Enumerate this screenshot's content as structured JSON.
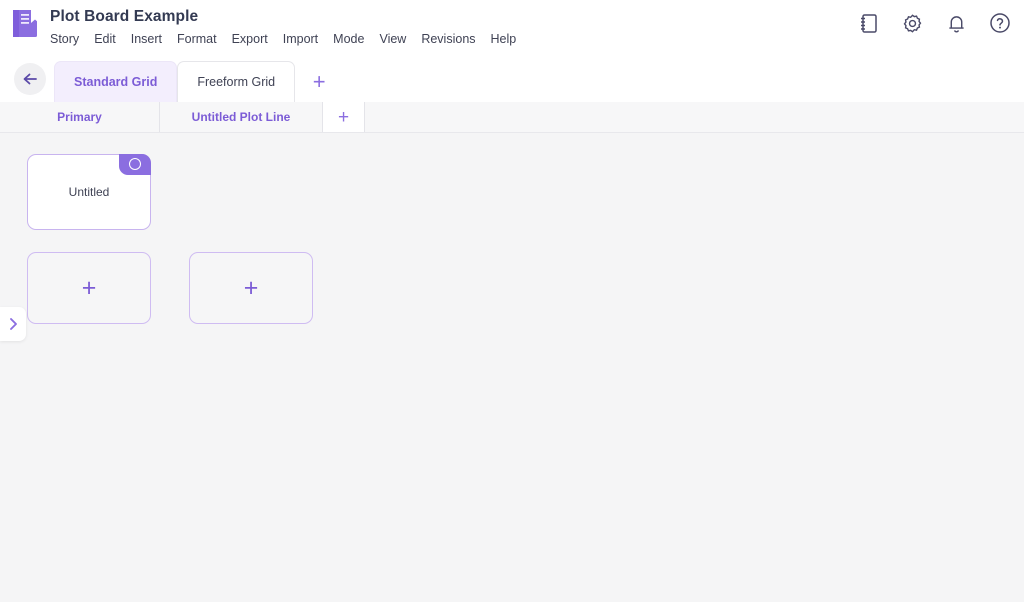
{
  "header": {
    "logo_icon": "book-logo-icon",
    "title": "Plot Board Example",
    "menu": [
      {
        "label": "Story"
      },
      {
        "label": "Edit"
      },
      {
        "label": "Insert"
      },
      {
        "label": "Format"
      },
      {
        "label": "Export"
      },
      {
        "label": "Import"
      },
      {
        "label": "Mode"
      },
      {
        "label": "View"
      },
      {
        "label": "Revisions"
      },
      {
        "label": "Help"
      }
    ],
    "actions": [
      {
        "icon": "notebook-icon"
      },
      {
        "icon": "gear-icon"
      },
      {
        "icon": "bell-icon"
      },
      {
        "icon": "help-circle-icon"
      }
    ]
  },
  "grid_tabs": {
    "back_icon": "arrow-left-icon",
    "tabs": [
      {
        "label": "Standard Grid",
        "active": true
      },
      {
        "label": "Freeform Grid",
        "active": false
      }
    ],
    "add_label": "+"
  },
  "plot_lines": {
    "cells": [
      {
        "label": "Primary"
      },
      {
        "label": "Untitled Plot Line"
      }
    ],
    "add_label": "+"
  },
  "board": {
    "cards": [
      {
        "label": "Untitled",
        "badge_icon": "circle-outline-icon"
      }
    ],
    "add_card_label": "+",
    "add_card_label_2": "+"
  },
  "side_panel": {
    "handle_icon": "chevron-right-icon"
  },
  "colors": {
    "accent": "#7c5cd6",
    "accent_light": "#8b6ee0",
    "tab_active_bg": "#f3eefd",
    "canvas_bg": "#f5f5f6",
    "card_border": "#c8b4ef",
    "title_text": "#333a52"
  }
}
